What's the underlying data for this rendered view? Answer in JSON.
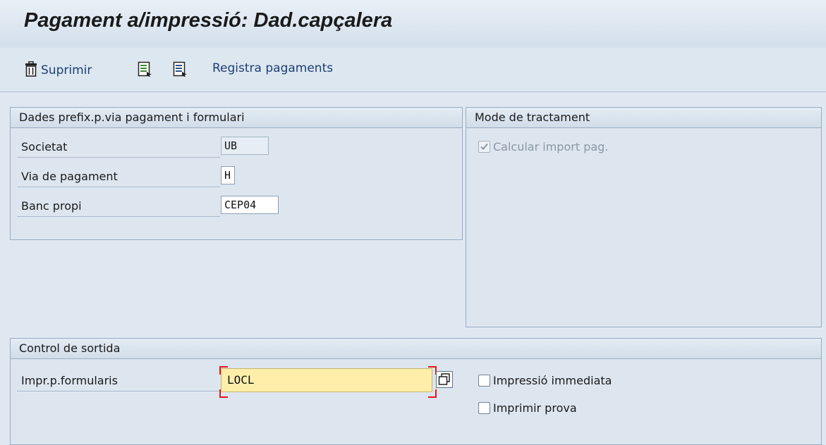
{
  "window": {
    "title": "Pagament a/impressió: Dad.capçalera"
  },
  "toolbar": {
    "delete_label": "Suprimir",
    "delete_icon": "trash-icon",
    "export_icon_1": "export-document-icon",
    "export_icon_2": "document-icon",
    "register_label": "Registra pagaments"
  },
  "group_prefix": {
    "header": "Dades prefix.p.via pagament i formulari",
    "fields": [
      {
        "label": "Societat",
        "value": "UB"
      },
      {
        "label": "Via de pagament",
        "value": "H"
      },
      {
        "label": "Banc propi",
        "value": "CEP04"
      }
    ]
  },
  "group_mode": {
    "header": "Mode de tractament",
    "calc_label": "Calcular import pag.",
    "calc_checked": true
  },
  "group_output": {
    "header": "Control de sortida",
    "printer_label": "Impr.p.formularis",
    "printer_value": "LOCL",
    "immediate_label": "Impressió immediata",
    "test_label": "Imprimir prova"
  },
  "colors": {
    "accent_link": "#1c3f73",
    "focus_field_bg": "#fdeeaa",
    "focus_marker": "#e01b1b"
  }
}
